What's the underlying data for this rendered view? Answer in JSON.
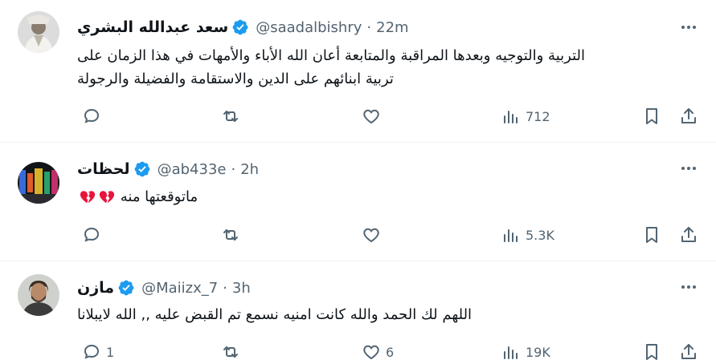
{
  "colors": {
    "text": "#0f1419",
    "secondary": "#536471",
    "verified": "#1d9bf0",
    "heart": "#f91880",
    "divider": "#eff3f4"
  },
  "tweets": [
    {
      "name": "سعد عبدالله البشري",
      "handle": "@saadalbishry",
      "separator": "·",
      "time": "22m",
      "text_line1": "التربية والتوجيه وبعدها المراقبة والمتابعة أعان الله الأباء والأمهات في هذا الزمان  على",
      "text_line2": "تربية ابنائهم على الدين والاستقامة والفضيلة والرجولة",
      "reply_count": "",
      "retweet_count": "",
      "like_count": "",
      "views": "712"
    },
    {
      "name": "لحظات",
      "handle": "@ab433e",
      "separator": "·",
      "time": "2h",
      "text_line1": "ماتوقعتها منه",
      "emoji": "broken-heart-icon x2",
      "reply_count": "",
      "retweet_count": "",
      "like_count": "",
      "views": "5.3K"
    },
    {
      "name": "مازن",
      "handle": "@Maiizx_7",
      "separator": "·",
      "time": "3h",
      "text_line1": "اللهم لك الحمد والله كانت امنيه نسمع تم القبض عليه ,, الله لايبلانا",
      "reply_count": "1",
      "retweet_count": "",
      "like_count": "6",
      "views": "19K"
    }
  ],
  "icons": [
    "more-icon",
    "reply-icon",
    "retweet-icon",
    "like-icon",
    "views-icon",
    "bookmark-icon",
    "share-icon",
    "verified-icon"
  ]
}
